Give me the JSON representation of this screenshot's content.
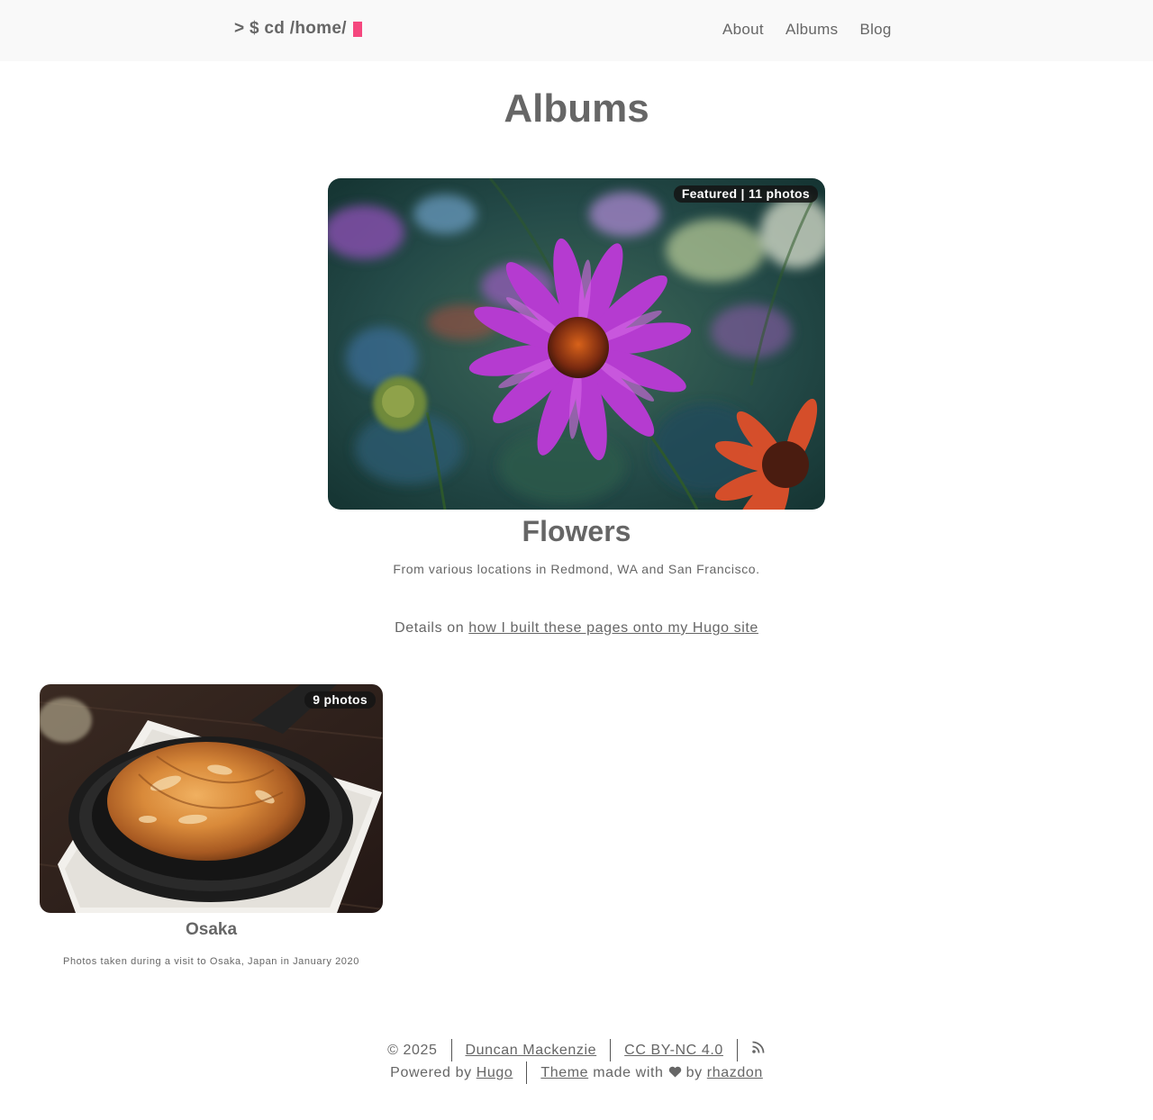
{
  "header": {
    "logo": "> $ cd /home/",
    "nav": [
      {
        "label": "About"
      },
      {
        "label": "Albums"
      },
      {
        "label": "Blog"
      }
    ],
    "accent_color": "#f5487f"
  },
  "page": {
    "title": "Albums"
  },
  "featured_album": {
    "badge": "Featured | 11 photos",
    "title": "Flowers",
    "description": "From various locations in Redmond, WA and San Francisco.",
    "image_subject": "purple coneflower"
  },
  "details": {
    "prefix": "Details on ",
    "link_text": "how I built these pages onto my Hugo site"
  },
  "albums": [
    {
      "badge": "9 photos",
      "title": "Osaka",
      "description": "Photos taken during a visit to Osaka, Japan in January 2020",
      "image_subject": "gyoza in cast iron pan"
    }
  ],
  "footer": {
    "copyright": "© 2025",
    "author_link": "Duncan Mackenzie",
    "license_link": "CC BY-NC 4.0",
    "rss_icon": "rss-icon",
    "powered_by_prefix": "Powered by ",
    "hugo_link": "Hugo",
    "theme_link": "Theme",
    "made_with": " made with ",
    "heart_icon": "heart-icon",
    "by_text": " by ",
    "rhazdon_link": "rhazdon"
  }
}
